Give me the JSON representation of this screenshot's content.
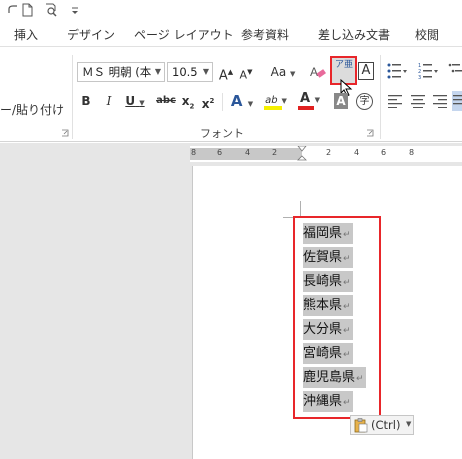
{
  "tabs": [
    "挿入",
    "デザイン",
    "ページ レイアウト",
    "参考資料",
    "差し込み文書",
    "校閲"
  ],
  "ribbon": {
    "paste_label": "ー/貼り付け",
    "font_name": "ＭＳ 明朝 (本",
    "font_size": "10.5",
    "grow_font": "A",
    "shrink_font": "A",
    "change_case": "Aa",
    "phonetic_guide": "ア亜",
    "char_border": "A",
    "bold": "B",
    "italic": "I",
    "underline": "U",
    "strikethrough": "abc",
    "subscript": "x",
    "superscript": "x",
    "text_effect": "A",
    "highlight": "ab",
    "font_color": "A",
    "char_shading": "A",
    "enclose_char": "字",
    "font_group_label": "フォント"
  },
  "ruler": {
    "left_numbers": [
      "8",
      "6",
      "4",
      "2"
    ],
    "right_numbers": [
      "2",
      "4",
      "6",
      "8"
    ]
  },
  "document": {
    "lines": [
      "福岡県",
      "佐賀県",
      "長崎県",
      "熊本県",
      "大分県",
      "宮崎県",
      "鹿児島県",
      "沖縄県"
    ],
    "paragraph_mark": "↵"
  },
  "paste_options": {
    "label": "(Ctrl)"
  },
  "colors": {
    "highlight_box": "#e8262a",
    "selection": "#c8c8c8",
    "font_color_bar": "#e02020",
    "highlight_bar": "#f5f000",
    "accent_blue": "#2b579a"
  }
}
